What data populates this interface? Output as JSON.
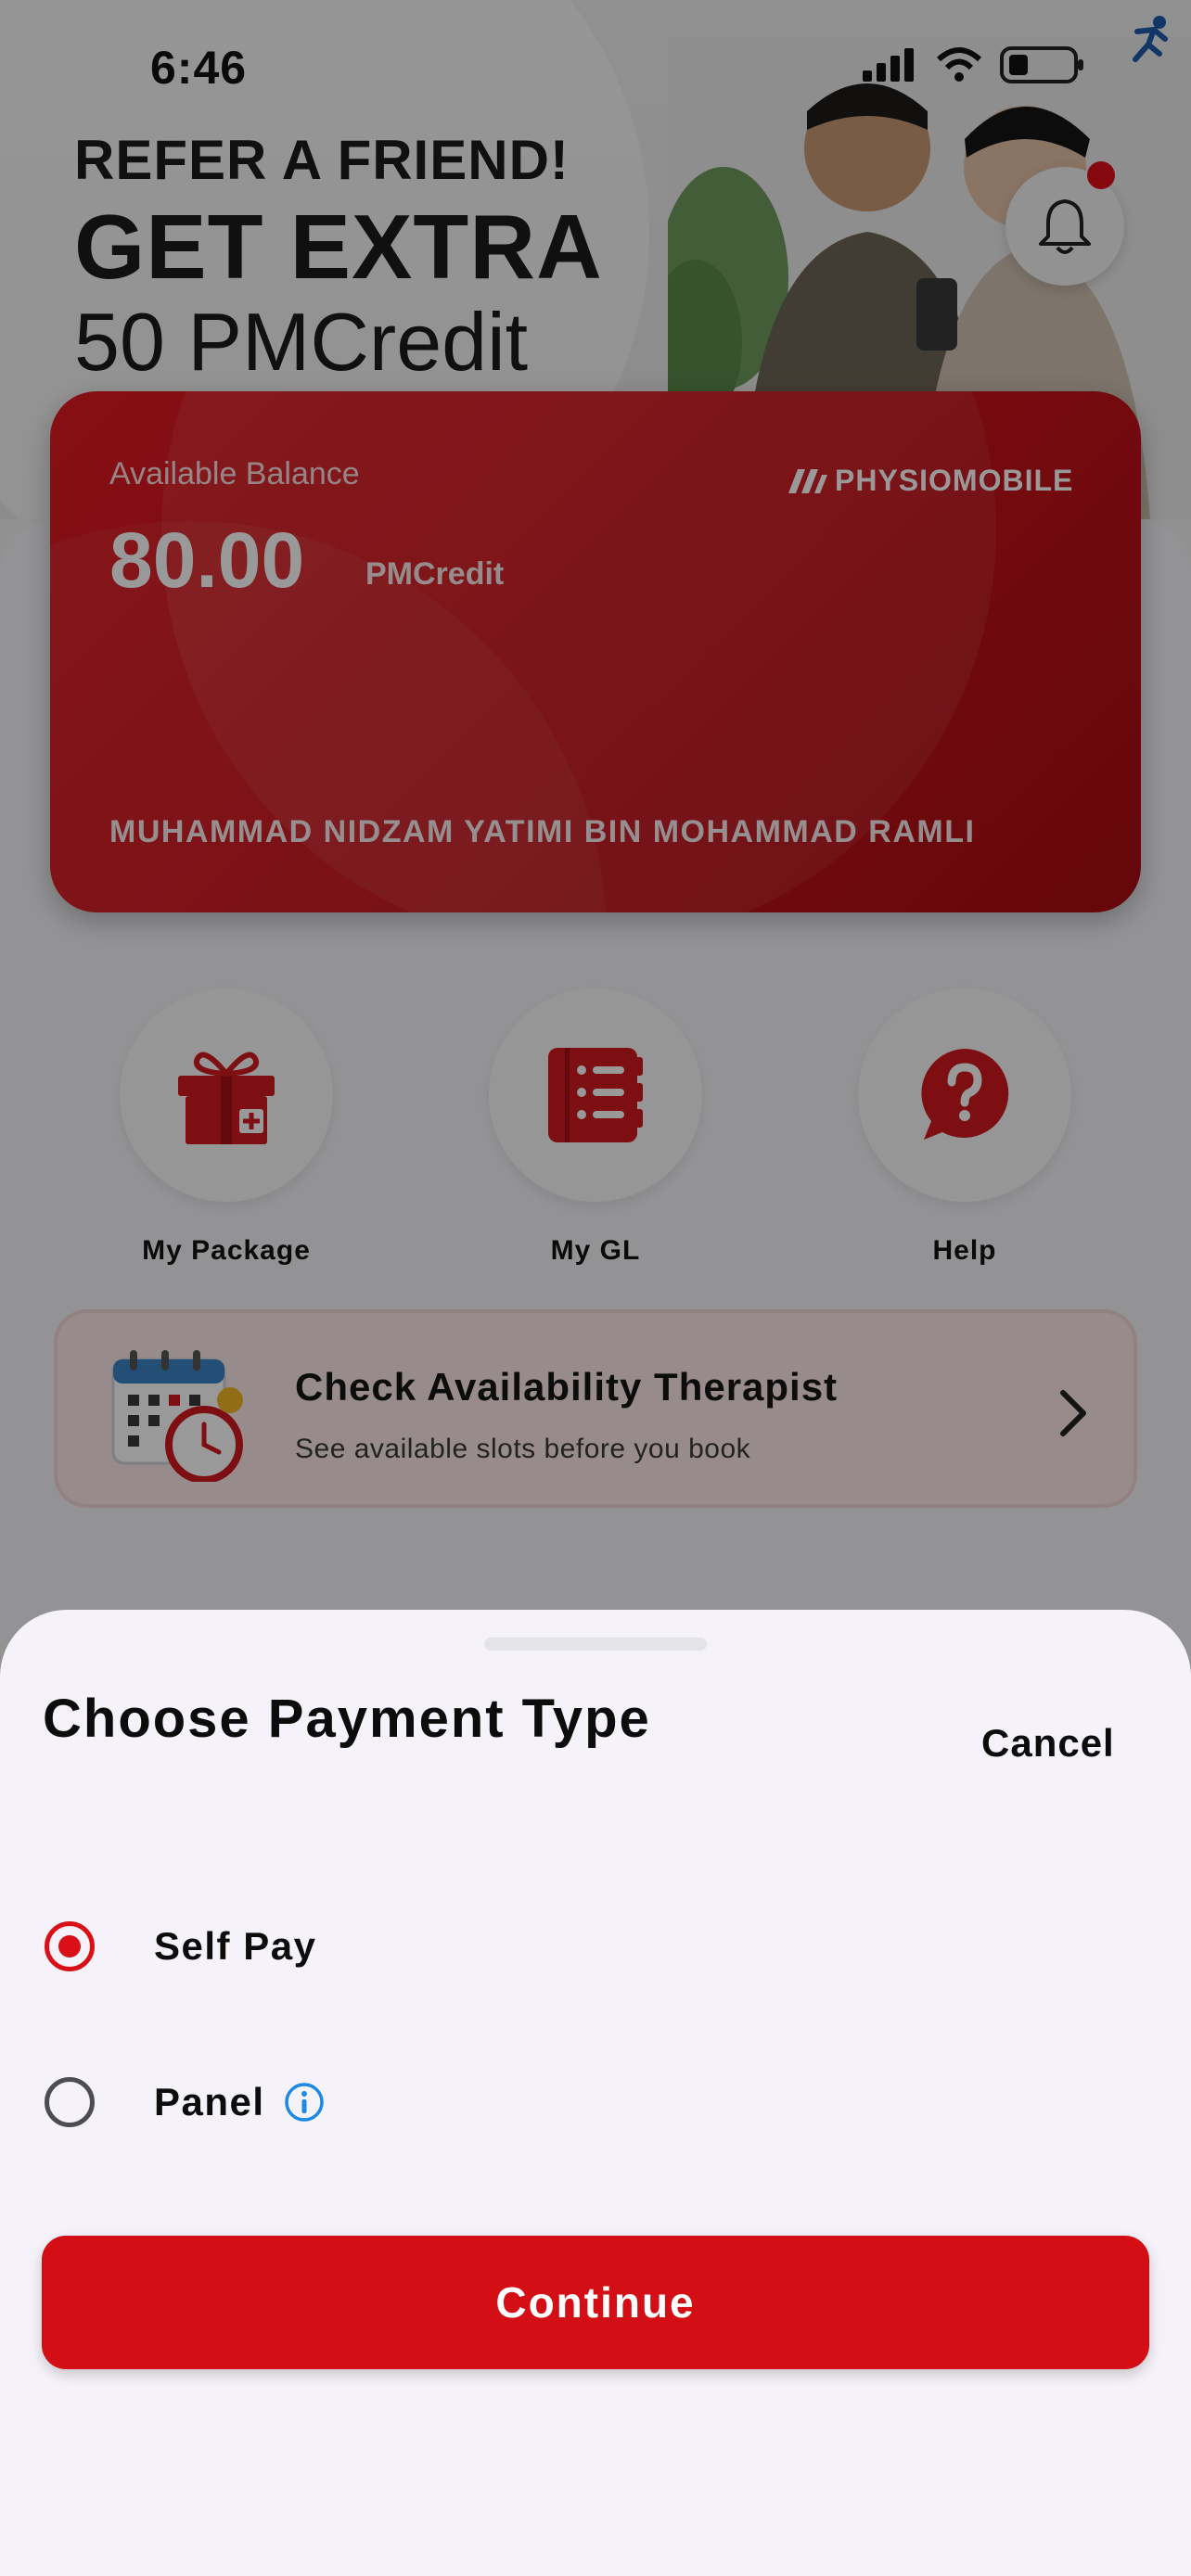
{
  "status_bar": {
    "time": "6:46"
  },
  "banner": {
    "line1": "REFER A FRIEND!",
    "line2": "GET EXTRA",
    "line3": "50 PMCredit"
  },
  "wallet_card": {
    "balance_label": "Available Balance",
    "balance_value": "80.00",
    "balance_unit": "PMCredit",
    "brand": "PHYSIOMOBILE",
    "holder_name": "MUHAMMAD NIDZAM YATIMI BIN MOHAMMAD RAMLI"
  },
  "shortcuts": [
    {
      "label": "My Package",
      "icon": "gift-icon"
    },
    {
      "label": "My GL",
      "icon": "notebook-icon"
    },
    {
      "label": "Help",
      "icon": "help-icon"
    }
  ],
  "availability": {
    "title": "Check Availability Therapist",
    "subtitle": "See available slots before you book"
  },
  "payment_sheet": {
    "title": "Choose Payment Type",
    "cancel_label": "Cancel",
    "options": [
      {
        "label": "Self Pay",
        "selected": true
      },
      {
        "label": "Panel",
        "selected": false,
        "has_info": true
      }
    ],
    "continue_label": "Continue"
  },
  "colors": {
    "accent": "#d30e14",
    "info": "#1e88e5"
  }
}
